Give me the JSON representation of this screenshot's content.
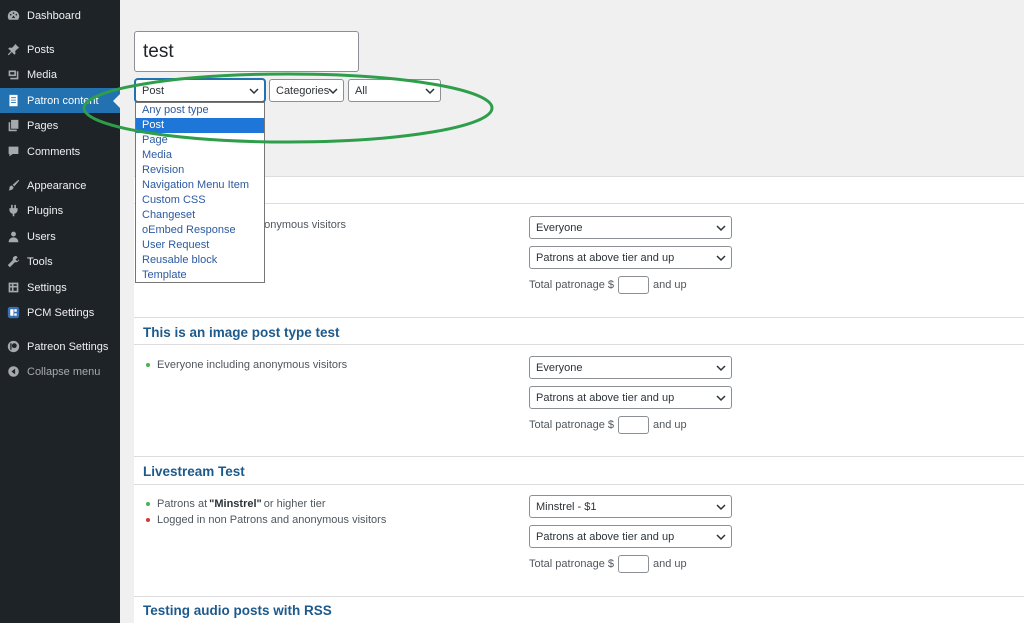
{
  "sidebar": {
    "items": [
      {
        "label": "Dashboard",
        "icon": "dashboard-icon"
      },
      {
        "label": "Posts",
        "icon": "pin-icon"
      },
      {
        "label": "Media",
        "icon": "media-icon"
      },
      {
        "label": "Patron content",
        "icon": "document-icon"
      },
      {
        "label": "Pages",
        "icon": "pages-icon"
      },
      {
        "label": "Comments",
        "icon": "comment-icon"
      },
      {
        "label": "Appearance",
        "icon": "paintbrush-icon"
      },
      {
        "label": "Plugins",
        "icon": "plug-icon"
      },
      {
        "label": "Users",
        "icon": "user-icon"
      },
      {
        "label": "Tools",
        "icon": "wrench-icon"
      },
      {
        "label": "Settings",
        "icon": "settings-icon"
      },
      {
        "label": "PCM Settings",
        "icon": "pcm-icon"
      },
      {
        "label": "Patreon Settings",
        "icon": "patreon-icon"
      },
      {
        "label": "Collapse menu",
        "icon": "collapse-icon"
      }
    ],
    "current": "Patron content"
  },
  "title_input": {
    "value": "test"
  },
  "filters": {
    "post_type": "Post",
    "taxonomy": "Categories",
    "term": "All"
  },
  "post_type_options": [
    "Any post type",
    "Post",
    "Page",
    "Media",
    "Revision",
    "Navigation Menu Item",
    "Custom CSS",
    "Changeset",
    "oEmbed Response",
    "User Request",
    "Reusable block",
    "Template"
  ],
  "selected_option": "Post",
  "sections": [
    {
      "title": "",
      "bullets": [
        {
          "text": "nonymous visitors",
          "color": "#46b450"
        }
      ],
      "level": "Everyone",
      "tier_scope": "Patrons at above tier and up",
      "total_label": "Total patronage $",
      "and_up": "and up"
    },
    {
      "title": "This is an image post type test",
      "bullets": [
        {
          "text": "Everyone including anonymous visitors",
          "color": "#46b450"
        }
      ],
      "level": "Everyone",
      "tier_scope": "Patrons at above tier and up",
      "total_label": "Total patronage $",
      "and_up": "and up"
    },
    {
      "title": "Livestream Test",
      "bullets": [
        {
          "pre": "Patrons at",
          "bold": "\"Minstrel\"",
          "post": "or higher tier",
          "color": "#46b450"
        },
        {
          "text": "Logged in non Patrons and anonymous visitors",
          "color": "#d63638"
        }
      ],
      "level": "Minstrel - $1",
      "tier_scope": "Patrons at above tier and up",
      "total_label": "Total patronage $",
      "and_up": "and up"
    },
    {
      "title": "Testing audio posts with RSS"
    }
  ],
  "colors": {
    "sidebar_bg": "#1d2327",
    "accent": "#2271b1",
    "annotation": "#2e9e4a",
    "heading": "#1d5a8c"
  }
}
